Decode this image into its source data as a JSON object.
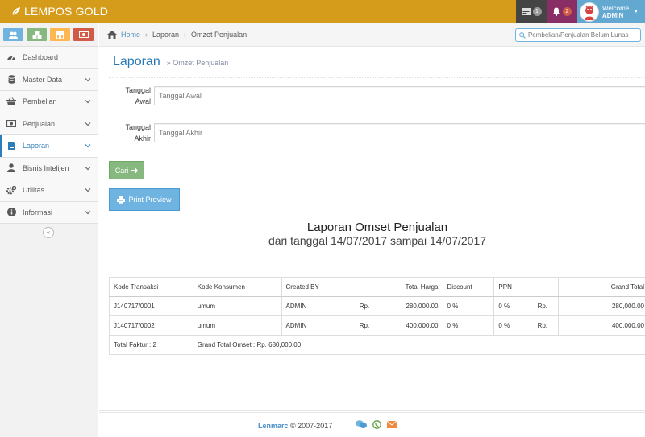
{
  "navbar": {
    "brand": "LEMPOS GOLD",
    "tasks_count": "1",
    "notifications_count": "2",
    "user_welcome": "Welcome,",
    "user_name": "ADMIN"
  },
  "sidebar": {
    "items": [
      {
        "label": "Dashboard",
        "icon": "dashboard-icon"
      },
      {
        "label": "Master Data",
        "icon": "database-icon"
      },
      {
        "label": "Pembelian",
        "icon": "basket-icon"
      },
      {
        "label": "Penjualan",
        "icon": "money-icon"
      },
      {
        "label": "Laporan",
        "icon": "file-icon"
      },
      {
        "label": "Bisnis Intelijen",
        "icon": "user-icon"
      },
      {
        "label": "Utilitas",
        "icon": "cogs-icon"
      },
      {
        "label": "Informasi",
        "icon": "info-icon"
      }
    ],
    "collapse_symbol": "«"
  },
  "breadcrumb": {
    "home": "Home",
    "items": [
      "Laporan",
      "Omzet Penjualan"
    ]
  },
  "search": {
    "placeholder": "Pembelian/Penjualan Belum Lunas"
  },
  "page": {
    "title": "Laporan",
    "subtitle": "» Omzet Penjualan"
  },
  "form": {
    "tanggal_awal_label_1": "Tanggal",
    "tanggal_awal_label_2": "Awal",
    "tanggal_awal_placeholder": "Tanggal Awal",
    "tanggal_akhir_label_1": "Tanggal",
    "tanggal_akhir_label_2": "Akhir",
    "tanggal_akhir_placeholder": "Tanggal Akhir",
    "cari_label": "Cari",
    "print_label": "Print Preview"
  },
  "report": {
    "title": "Laporan Omset Penjualan",
    "subtitle": "dari tanggal 14/07/2017 sampai 14/07/2017",
    "headers": {
      "kode_transaksi": "Kode Transaksi",
      "kode_konsumen": "Kode Konsumen",
      "created_by": "Created BY",
      "total_harga": "Total Harga",
      "discount": "Discount",
      "ppn": "PPN",
      "grand_total": "Grand Total"
    },
    "rows": [
      {
        "kode": "J140717/0001",
        "konsumen": "umum",
        "created_by": "ADMIN",
        "rp1": "Rp.",
        "total_harga": "280,000.00",
        "discount": "0 %",
        "ppn": "0 %",
        "rp2": "Rp.",
        "grand_total": "280,000.00"
      },
      {
        "kode": "J140717/0002",
        "konsumen": "umum",
        "created_by": "ADMIN",
        "rp1": "Rp.",
        "total_harga": "400,000.00",
        "discount": "0 %",
        "ppn": "0 %",
        "rp2": "Rp.",
        "grand_total": "400,000.00"
      }
    ],
    "total_faktur": "Total Faktur : 2",
    "grand_total_omset": "Grand Total Omset : Rp. 680,000.00"
  },
  "footer": {
    "brand": "Lenmarc",
    "copyright": " © 2007-2017"
  }
}
